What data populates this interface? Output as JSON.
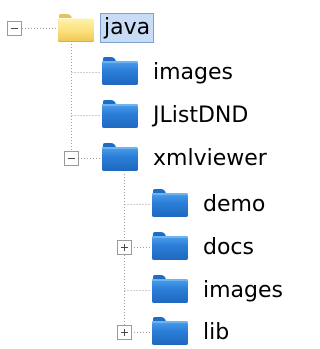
{
  "tree": {
    "root": {
      "label": "java",
      "expanded": true,
      "selected": true
    },
    "children": [
      {
        "label": "images"
      },
      {
        "label": "JListDND"
      },
      {
        "label": "xmlviewer",
        "expanded": true,
        "children": [
          {
            "label": "demo"
          },
          {
            "label": "docs",
            "expanded": false
          },
          {
            "label": "images"
          },
          {
            "label": "lib",
            "expanded": false
          }
        ]
      }
    ]
  },
  "colors": {
    "selection_fill": "#c8dcf7",
    "selection_border": "#7da2ce",
    "folder_blue": "#2b7fd8",
    "folder_yellow": "#fbe07c",
    "connector": "#a0a0a0"
  },
  "icons": {
    "root": "folder-open-yellow-icon",
    "child": "folder-blue-icon",
    "collapse": "minus-box-icon",
    "expand": "plus-box-icon"
  }
}
